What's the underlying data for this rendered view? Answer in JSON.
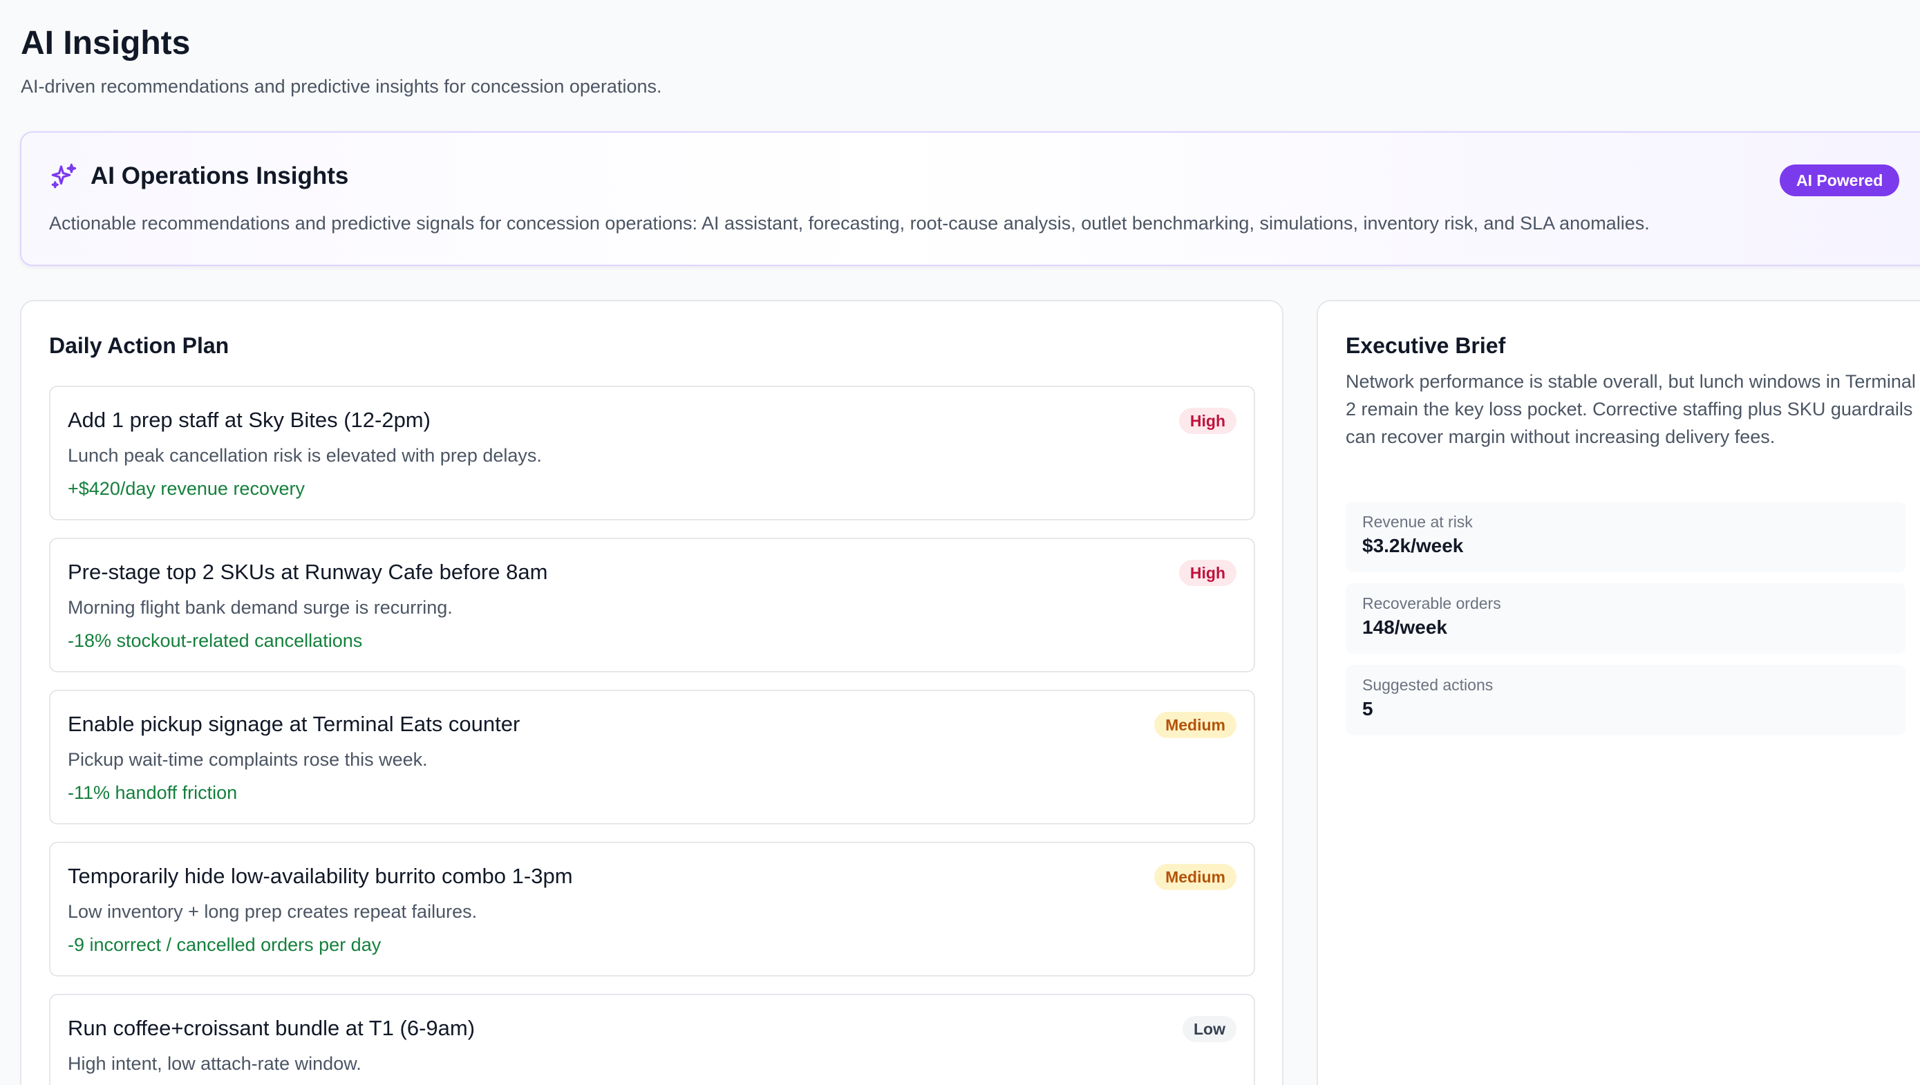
{
  "page": {
    "title": "AI Insights",
    "subtitle": "AI-driven recommendations and predictive insights for concession operations."
  },
  "ai_card": {
    "icon": "sparkles-icon",
    "title": "AI Operations Insights",
    "badge": "AI Powered",
    "description": "Actionable recommendations and predictive signals for concession operations: AI assistant, forecasting, root-cause analysis, outlet benchmarking, simulations, inventory risk, and SLA anomalies.",
    "accent_color": "#7c3aed"
  },
  "action_plan": {
    "title": "Daily Action Plan",
    "items": [
      {
        "title": "Add 1 prep staff at Sky Bites (12-2pm)",
        "description": "Lunch peak cancellation risk is elevated with prep delays.",
        "impact": "+$420/day revenue recovery",
        "priority": "High"
      },
      {
        "title": "Pre-stage top 2 SKUs at Runway Cafe before 8am",
        "description": "Morning flight bank demand surge is recurring.",
        "impact": "-18% stockout-related cancellations",
        "priority": "High"
      },
      {
        "title": "Enable pickup signage at Terminal Eats counter",
        "description": "Pickup wait-time complaints rose this week.",
        "impact": "-11% handoff friction",
        "priority": "Medium"
      },
      {
        "title": "Temporarily hide low-availability burrito combo 1-3pm",
        "description": "Low inventory + long prep creates repeat failures.",
        "impact": "-9 incorrect / cancelled orders per day",
        "priority": "Medium"
      },
      {
        "title": "Run coffee+croissant bundle at T1 (6-9am)",
        "description": "High intent, low attach-rate window.",
        "impact": "",
        "priority": "Low"
      }
    ]
  },
  "executive_brief": {
    "title": "Executive Brief",
    "text": "Network performance is stable overall, but lunch windows in Terminal 2 remain the key loss pocket. Corrective staffing plus SKU guardrails can recover margin without increasing delivery fees.",
    "metrics": [
      {
        "label": "Revenue at risk",
        "value": "$3.2k/week"
      },
      {
        "label": "Recoverable orders",
        "value": "148/week"
      },
      {
        "label": "Suggested actions",
        "value": "5"
      }
    ]
  }
}
